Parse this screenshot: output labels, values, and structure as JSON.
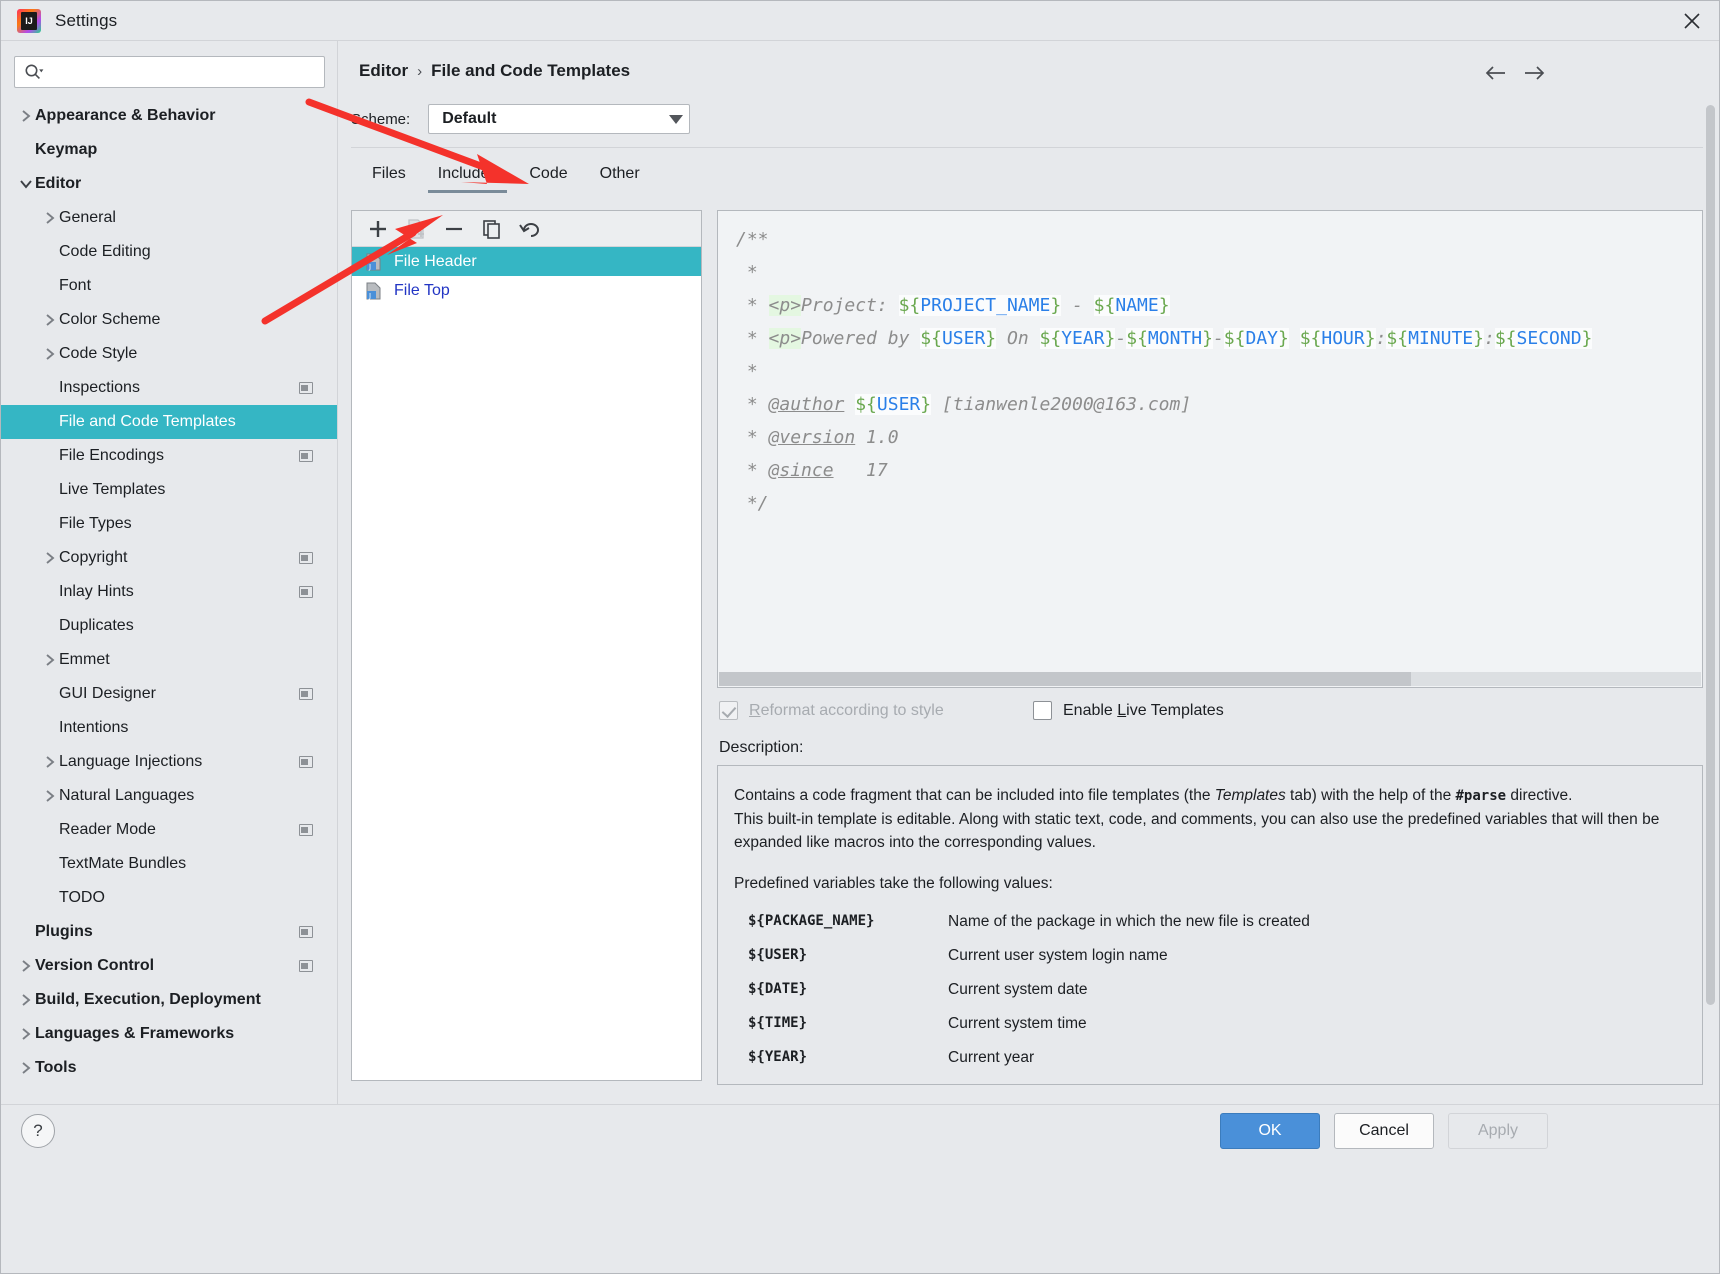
{
  "window": {
    "title": "Settings",
    "logo_icon": "intellij-idea-logo",
    "close_icon": "close-icon"
  },
  "search": {
    "value": "",
    "placeholder": "",
    "icon": "search-icon"
  },
  "sidebar": {
    "scrollbar": "vertical-scrollbar",
    "items": [
      {
        "label": "Appearance & Behavior",
        "level": 0,
        "bold": true,
        "arrow": "chevron-right",
        "badge": false
      },
      {
        "label": "Keymap",
        "level": 0,
        "bold": true,
        "arrow": "none",
        "badge": false
      },
      {
        "label": "Editor",
        "level": 0,
        "bold": true,
        "arrow": "chevron-down",
        "badge": false
      },
      {
        "label": "General",
        "level": 1,
        "bold": false,
        "arrow": "chevron-right",
        "badge": false
      },
      {
        "label": "Code Editing",
        "level": 1,
        "bold": false,
        "arrow": "none",
        "badge": false
      },
      {
        "label": "Font",
        "level": 1,
        "bold": false,
        "arrow": "none",
        "badge": false
      },
      {
        "label": "Color Scheme",
        "level": 1,
        "bold": false,
        "arrow": "chevron-right",
        "badge": false
      },
      {
        "label": "Code Style",
        "level": 1,
        "bold": false,
        "arrow": "chevron-right",
        "badge": false
      },
      {
        "label": "Inspections",
        "level": 1,
        "bold": false,
        "arrow": "none",
        "badge": true
      },
      {
        "label": "File and Code Templates",
        "level": 1,
        "bold": false,
        "arrow": "none",
        "badge": false,
        "selected": true
      },
      {
        "label": "File Encodings",
        "level": 1,
        "bold": false,
        "arrow": "none",
        "badge": true
      },
      {
        "label": "Live Templates",
        "level": 1,
        "bold": false,
        "arrow": "none",
        "badge": false
      },
      {
        "label": "File Types",
        "level": 1,
        "bold": false,
        "arrow": "none",
        "badge": false
      },
      {
        "label": "Copyright",
        "level": 1,
        "bold": false,
        "arrow": "chevron-right",
        "badge": true
      },
      {
        "label": "Inlay Hints",
        "level": 1,
        "bold": false,
        "arrow": "none",
        "badge": true
      },
      {
        "label": "Duplicates",
        "level": 1,
        "bold": false,
        "arrow": "none",
        "badge": false
      },
      {
        "label": "Emmet",
        "level": 1,
        "bold": false,
        "arrow": "chevron-right",
        "badge": false
      },
      {
        "label": "GUI Designer",
        "level": 1,
        "bold": false,
        "arrow": "none",
        "badge": true
      },
      {
        "label": "Intentions",
        "level": 1,
        "bold": false,
        "arrow": "none",
        "badge": false
      },
      {
        "label": "Language Injections",
        "level": 1,
        "bold": false,
        "arrow": "chevron-right",
        "badge": true
      },
      {
        "label": "Natural Languages",
        "level": 1,
        "bold": false,
        "arrow": "chevron-right",
        "badge": false
      },
      {
        "label": "Reader Mode",
        "level": 1,
        "bold": false,
        "arrow": "none",
        "badge": true
      },
      {
        "label": "TextMate Bundles",
        "level": 1,
        "bold": false,
        "arrow": "none",
        "badge": false
      },
      {
        "label": "TODO",
        "level": 1,
        "bold": false,
        "arrow": "none",
        "badge": false
      },
      {
        "label": "Plugins",
        "level": 0,
        "bold": true,
        "arrow": "none",
        "badge": true
      },
      {
        "label": "Version Control",
        "level": 0,
        "bold": true,
        "arrow": "chevron-right",
        "badge": true
      },
      {
        "label": "Build, Execution, Deployment",
        "level": 0,
        "bold": true,
        "arrow": "chevron-right",
        "badge": false
      },
      {
        "label": "Languages & Frameworks",
        "level": 0,
        "bold": true,
        "arrow": "chevron-right",
        "badge": false
      },
      {
        "label": "Tools",
        "level": 0,
        "bold": true,
        "arrow": "chevron-right",
        "badge": false
      }
    ]
  },
  "content": {
    "breadcrumb": {
      "parent": "Editor",
      "separator": "›",
      "current": "File and Code Templates"
    },
    "nav": {
      "back_icon": "arrow-left-icon",
      "forward_icon": "arrow-right-icon"
    },
    "scheme": {
      "label": "Scheme:",
      "value": "Default",
      "arrow_icon": "chevron-down-icon"
    },
    "tabs": [
      {
        "label": "Files",
        "active": false
      },
      {
        "label": "Includes",
        "active": true
      },
      {
        "label": "Code",
        "active": false
      },
      {
        "label": "Other",
        "active": false
      }
    ],
    "toolbar": [
      {
        "name": "add-button",
        "icon": "plus-icon",
        "label": "+",
        "disabled": false
      },
      {
        "name": "save-as-button",
        "icon": "save-as-icon",
        "label": "",
        "disabled": true
      },
      {
        "name": "remove-button",
        "icon": "minus-icon",
        "label": "−",
        "disabled": false
      },
      {
        "name": "copy-button",
        "icon": "copy-icon",
        "label": "",
        "disabled": false
      },
      {
        "name": "reset-button",
        "icon": "undo-arrow-icon",
        "label": "",
        "disabled": false
      }
    ],
    "templates": [
      {
        "label": "File Header",
        "icon": "java-template-icon",
        "selected": true
      },
      {
        "label": "File Top",
        "icon": "java-template-icon",
        "selected": false
      }
    ],
    "editor": {
      "lines": [
        "/**",
        " *",
        " * <p>Project: ${PROJECT_NAME} - ${NAME}",
        " * <p>Powered by ${USER} On ${YEAR}-${MONTH}-${DAY} ${HOUR}:${MINUTE}:${SECOND}",
        " *",
        " * @author ${USER} [tianwenle2000@163.com]",
        " * @version 1.0",
        " * @since   17",
        " */"
      ],
      "scrollbar": "horizontal-scrollbar"
    },
    "checkboxes": [
      {
        "label": "Reformat according to style",
        "checked": true,
        "disabled": true,
        "mnemonic": "R"
      },
      {
        "label": "Enable Live Templates",
        "checked": false,
        "disabled": false,
        "mnemonic": "L"
      }
    ],
    "description": {
      "title": "Description:",
      "paragraph1_a": "Contains a code fragment that can be included into file templates (the ",
      "paragraph1_italic": "Templates",
      "paragraph1_b": " tab) with the help of the ",
      "paragraph1_mono": "#parse",
      "paragraph1_c": " directive.",
      "paragraph2": "This built-in template is editable. Along with static text, code, and comments, you can also use the predefined variables that will then be expanded like macros into the corresponding values.",
      "paragraph3": "Predefined variables take the following values:",
      "variables": [
        {
          "name": "${PACKAGE_NAME}",
          "desc": "Name of the package in which the new file is created"
        },
        {
          "name": "${USER}",
          "desc": "Current user system login name"
        },
        {
          "name": "${DATE}",
          "desc": "Current system date"
        },
        {
          "name": "${TIME}",
          "desc": "Current system time"
        },
        {
          "name": "${YEAR}",
          "desc": "Current year"
        }
      ]
    }
  },
  "footer": {
    "help_label": "?",
    "ok_label": "OK",
    "cancel_label": "Cancel",
    "apply_label": "Apply"
  },
  "colors": {
    "selection": "#35b6c4",
    "primary_button": "#4a90d9",
    "annotation_arrow": "#f4322b",
    "link_text": "#2235c4"
  }
}
